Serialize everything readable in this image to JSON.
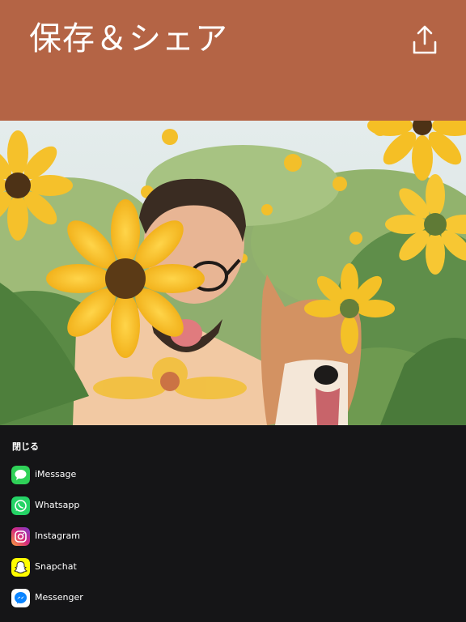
{
  "header": {
    "title": "保存＆シェア",
    "background": "#b46445",
    "share_icon": "share-upload-icon"
  },
  "photo": {
    "subject": "man with sunflower and shiba dog in sunflower field"
  },
  "sheet": {
    "close_label": "閉じる",
    "items": [
      {
        "label": "iMessage",
        "icon": "imessage-icon",
        "color": "#2fd158"
      },
      {
        "label": "Whatsapp",
        "icon": "whatsapp-icon",
        "color": "#25d366"
      },
      {
        "label": "Instagram",
        "icon": "instagram-icon",
        "color": "#c13584"
      },
      {
        "label": "Snapchat",
        "icon": "snapchat-icon",
        "color": "#fffc00"
      },
      {
        "label": "Messenger",
        "icon": "messenger-icon",
        "color": "#0a84ff"
      }
    ]
  }
}
